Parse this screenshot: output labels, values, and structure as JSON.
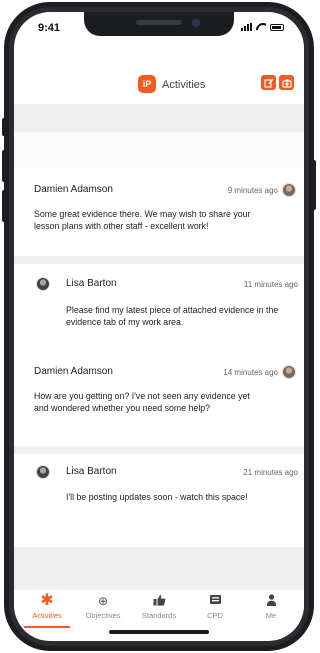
{
  "status_bar": {
    "time": "9:41"
  },
  "header": {
    "logo_text": "iP",
    "title": "Activities",
    "actions": [
      {
        "icon": "compose-icon"
      },
      {
        "icon": "camera-icon"
      }
    ]
  },
  "activities": [
    {
      "author": "Damien Adamson",
      "time": "9 minutes ago",
      "message": "Some great evidence there. We may wish to share your lesson plans with other staff - excellent work!",
      "avatar_side": "right"
    },
    {
      "author": "Lisa Barton",
      "time": "11 minutes ago",
      "message": "Please find my latest piece of attached evidence in the evidence tab of my work area.",
      "avatar_side": "left"
    },
    {
      "author": "Damien Adamson",
      "time": "14 minutes ago",
      "message": "How are you getting on? I've not seen any evidence yet and wondered whether you need some help?",
      "avatar_side": "right"
    },
    {
      "author": "Lisa Barton",
      "time": "21 minutes ago",
      "message": "I'll be posting updates soon - watch this space!",
      "avatar_side": "left"
    }
  ],
  "tabs": [
    {
      "label": "Activities",
      "icon": "asterisk-icon",
      "active": true
    },
    {
      "label": "Objectives",
      "icon": "target-icon",
      "active": false
    },
    {
      "label": "Standards",
      "icon": "thumbs-up-icon",
      "active": false
    },
    {
      "label": "CPD",
      "icon": "card-icon",
      "active": false
    },
    {
      "label": "Me",
      "icon": "person-icon",
      "active": false
    }
  ],
  "colors": {
    "accent": "#f25a1f",
    "band": "#f0f0f1",
    "text": "#1e1e1e"
  }
}
